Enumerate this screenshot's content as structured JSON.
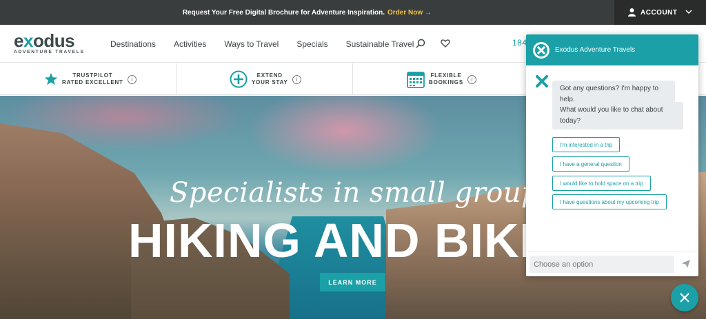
{
  "topbar": {
    "promo_text": "Request Your Free Digital Brochure for Adventure Inspiration.",
    "promo_cta": "Order Now",
    "promo_arrow": "→",
    "account_label": "ACCOUNT"
  },
  "logo": {
    "word_pre": "e",
    "word_x": "x",
    "word_post": "odus",
    "tagline": "ADVENTURE TRAVELS"
  },
  "nav": {
    "items": [
      "Destinations",
      "Activities",
      "Ways to Travel",
      "Specials",
      "Sustainable Travel"
    ],
    "phone_partial": "184"
  },
  "usp": [
    {
      "line1": "TRUSTPILOT",
      "line2": "RATED EXCELLENT",
      "icon": "star-icon"
    },
    {
      "line1": "EXTEND",
      "line2": "YOUR STAY",
      "icon": "plus-circle-icon"
    },
    {
      "line1": "FLEXIBLE",
      "line2": "BOOKINGS",
      "icon": "calendar-icon"
    }
  ],
  "info_glyph": "i",
  "hero": {
    "script_text": "Specialists in small groups",
    "headline": "HIKING AND BIKING",
    "button": "LEARN MORE"
  },
  "chat": {
    "title": "Exodus Adventure Travels",
    "messages": [
      "Got any questions? I'm happy to help.",
      "What would you like to chat about today?"
    ],
    "options": [
      "I'm interested in a trip",
      "I have a general question",
      "I would like to hold space on a trip",
      "I have questions about my upcoming trip"
    ],
    "input_placeholder": "Choose an option"
  },
  "colors": {
    "brand_teal": "#1aa0a6",
    "topbar_bg": "#3a3d3d",
    "promo_accent": "#f6c343"
  }
}
